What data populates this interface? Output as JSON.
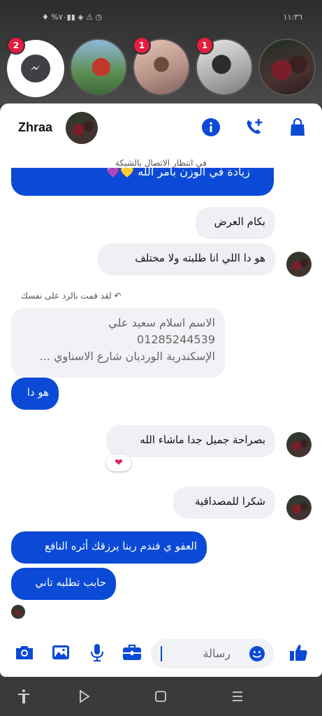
{
  "status_bar": {
    "time": "١١:٣٦",
    "icons_text": "♦ %٧٠▮▮ ◈ ⚠ ◷"
  },
  "chat_heads": [
    {
      "name": "messenger-head",
      "badge": "2"
    },
    {
      "name": "chat-head-1",
      "badge": ""
    },
    {
      "name": "chat-head-2",
      "badge": "1"
    },
    {
      "name": "chat-head-3",
      "badge": "1"
    },
    {
      "name": "chat-head-4",
      "badge": ""
    }
  ],
  "header": {
    "name": "Zhraa"
  },
  "network_status": "في انتظار الاتصال بالشبكة",
  "messages": {
    "cut_top": "زيادة في الوزن بأمر الله 💛💜",
    "m1": "بكام العرض",
    "m2": "هو دا اللي انا طلبته ولا مختلف",
    "replied_label": "لقد قمت بالرد على نفسك",
    "quoted_line1": "الاسم اسلام سعيد علي",
    "quoted_line2": "01285244539",
    "quoted_line3": "الإسكندرية الورديان شارع الاسناوي ...",
    "m3": "هو دا",
    "m4": "بصراحة جميل جدا ماشاء الله",
    "reaction": "❤",
    "m5": "شكرا للمصداقية",
    "m6": "العفو ي فندم ربنا يرزقك أثره النافع",
    "m7": "حابب تطلبه تاني"
  },
  "composer": {
    "placeholder": "رسالة"
  },
  "colors": {
    "accent": "#0a4ad6",
    "badge": "#e41e3f",
    "their_bubble": "#eef0f3"
  }
}
